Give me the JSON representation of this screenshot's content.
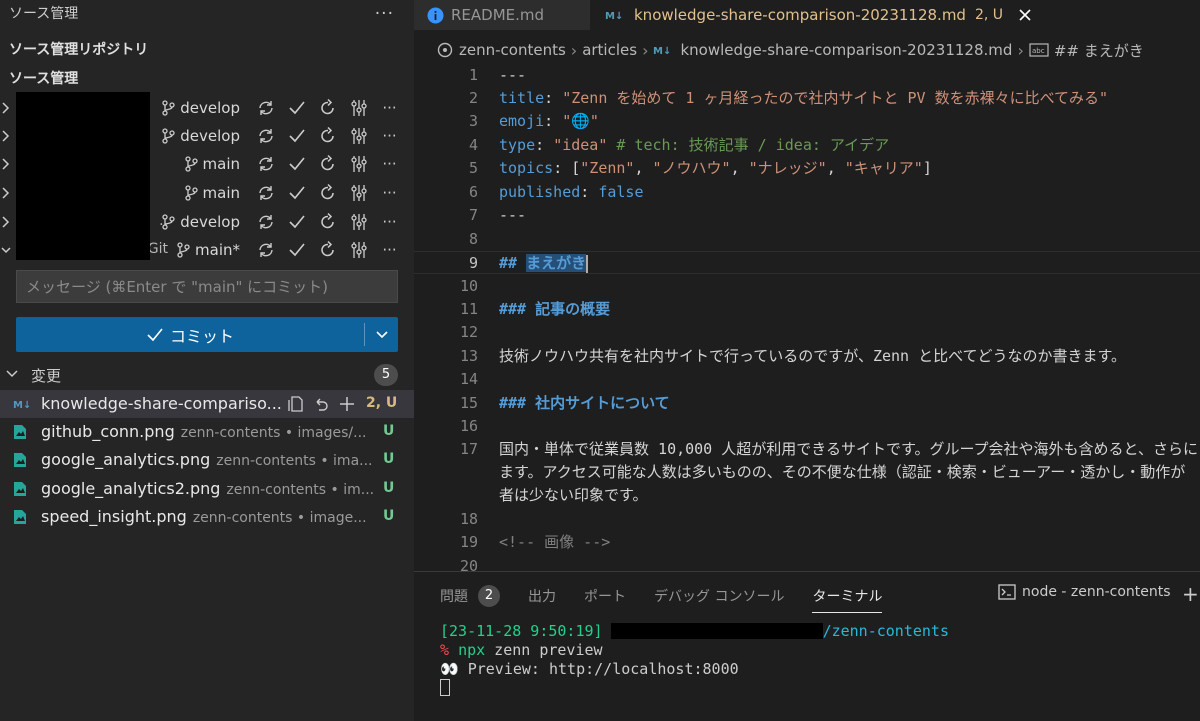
{
  "sidebar": {
    "title": "ソース管理",
    "more_label": "···",
    "repos_header": "ソース管理リポジトリ",
    "scm_header": "ソース管理",
    "repos": [
      {
        "name": "",
        "branch": "develop"
      },
      {
        "name": ".",
        "branch": "develop"
      },
      {
        "name": "",
        "branch": "main"
      },
      {
        "name": "",
        "branch": "main"
      },
      {
        "name": "..",
        "branch": "develop"
      },
      {
        "name": "Git",
        "branch": "main*"
      }
    ],
    "commit_message_placeholder": "メッセージ (⌘Enter で \"main\" にコミット)",
    "commit_label": "コミット",
    "changes_label": "変更",
    "changes_count": "5",
    "files": [
      {
        "name": "knowledge-share-compariso...",
        "desc": "",
        "status": "2, U"
      },
      {
        "name": "github_conn.png",
        "desc": "zenn-contents • images/...",
        "status": "U"
      },
      {
        "name": "google_analytics.png",
        "desc": "zenn-contents • ima...",
        "status": "U"
      },
      {
        "name": "google_analytics2.png",
        "desc": "zenn-contents • im...",
        "status": "U"
      },
      {
        "name": "speed_insight.png",
        "desc": "zenn-contents • image...",
        "status": "U"
      }
    ]
  },
  "tabs": [
    {
      "label": "README.md"
    },
    {
      "label": "knowledge-share-comparison-20231128.md",
      "badge": "2, U"
    }
  ],
  "breadcrumb": {
    "root": "zenn-contents",
    "folder": "articles",
    "file": "knowledge-share-comparison-20231128.md",
    "symbol": "## まえがき"
  },
  "code": {
    "line_numbers": [
      "1",
      "2",
      "3",
      "4",
      "5",
      "6",
      "7",
      "8",
      "9",
      "10",
      "11",
      "12",
      "13",
      "14",
      "15",
      "16",
      "17",
      "",
      "",
      "18",
      "19",
      "20"
    ],
    "l1": "---",
    "l2_key": "title",
    "l2_val": "\"Zenn を始めて 1 ヶ月経ったので社内サイトと PV 数を赤裸々に比べてみる\"",
    "l3_key": "emoji",
    "l3_val": "\"🌐\"",
    "l4_key": "type",
    "l4_val": "\"idea\"",
    "l4_comment": "# tech: 技術記事 / idea: アイデア",
    "l5_key": "topics",
    "l5_vals": [
      "\"Zenn\"",
      "\"ノウハウ\"",
      "\"ナレッジ\"",
      "\"キャリア\""
    ],
    "l6_key": "published",
    "l6_val": "false",
    "l7": "---",
    "l9_hash": "##",
    "l9_text": "まえがき",
    "l11": "### 記事の概要",
    "l13": "技術ノウハウ共有を社内サイトで行っているのですが、Zenn と比べてどうなのか書きます。",
    "l15": "### 社内サイトについて",
    "l17a": "国内・単体で従業員数 10,000 人超が利用できるサイトです。グループ会社や海外も含めると、さらに",
    "l17b": "ます。アクセス可能な人数は多いものの、その不便な仕様（認証・検索・ビューアー・透かし・動作が",
    "l17c": "者は少ない印象です。",
    "l19": "<!-- 画像 -->"
  },
  "panel": {
    "tabs": [
      "問題",
      "出力",
      "ポート",
      "デバッグ コンソール",
      "ターミナル"
    ],
    "problems_count": "2",
    "active_tab": "ターミナル",
    "terminal_name": "node - zenn-contents",
    "plus": "+",
    "terminal": {
      "timestamp": "[23-11-28 9:50:19]",
      "path": "/zenn-contents",
      "prompt": "%",
      "cmd_npx": "npx",
      "cmd_rest": " zenn preview",
      "preview": "👀 Preview: http://localhost:8000"
    }
  }
}
